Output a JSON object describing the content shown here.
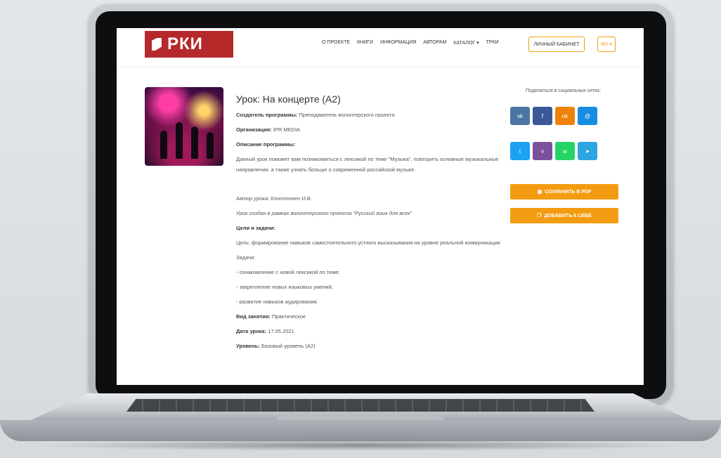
{
  "header": {
    "logo_text": "РКИ",
    "nav": [
      "О ПРОЕКТЕ",
      "КНИГИ",
      "ИНФОРМАЦИЯ",
      "АВТОРАМ",
      "КАТАЛОГ ▾",
      "ТРКИ"
    ],
    "cabinet_button": "ЛИЧНЫЙ КАБИНЕТ",
    "lang_button": "RU ▾"
  },
  "lesson": {
    "title": "Урок: На концерте (А2)",
    "creator_label": "Создатель программы:",
    "creator_value": "Преподаватель волонтерского проекта",
    "org_label": "Организация:",
    "org_value": "IPR MEDIA",
    "desc_label": "Описание программы:",
    "desc_text": "Данный урок поможет вам познакомиться с лексикой по теме \"Музыка\", повторить основные музыкальные направления, а также узнать больше о современной российской музыке.",
    "author_line": "Автор урока: Конттонен И.В.",
    "project_line": "Урок создан в рамках волонтерского проекта \"Русский язык для всех\"",
    "goals_label": "Цели и задачи:",
    "goal_text": "Цель: формирование навыков самостоятельного устного высказывания на уровне реальной коммуникации",
    "tasks_label": "Задачи:",
    "tasks": [
      "- ознакомление с новой лексикой по теме;",
      "- закрепление новых языковых умений;",
      "- развитие навыков аудирования."
    ],
    "type_label": "Вид занятия:",
    "type_value": "Практическое",
    "date_label": "Дата урока:",
    "date_value": "17.05.2021",
    "level_label": "Уровень:",
    "level_value": "Базовый уровень (А2)"
  },
  "share": {
    "label": "Поделиться в социальных сетях:",
    "buttons": [
      {
        "name": "vk",
        "glyph": "vk",
        "color": "#4c75a3"
      },
      {
        "name": "facebook",
        "glyph": "f",
        "color": "#3b5998"
      },
      {
        "name": "odnoklassniki",
        "glyph": "ok",
        "color": "#ee8208"
      },
      {
        "name": "moi-mir",
        "glyph": "@",
        "color": "#168de2"
      },
      {
        "name": "twitter",
        "glyph": "t",
        "color": "#1da1f2"
      },
      {
        "name": "viber",
        "glyph": "v",
        "color": "#7b519d"
      },
      {
        "name": "whatsapp",
        "glyph": "w",
        "color": "#25d366"
      },
      {
        "name": "telegram",
        "glyph": "➤",
        "color": "#2ca5e0"
      }
    ]
  },
  "actions": {
    "save_pdf": "СОХРАНИТЬ В PDF",
    "add_self": "ДОБАВИТЬ К СЕБЕ"
  },
  "colors": {
    "brand": "#b5292b",
    "accent": "#f39c12"
  }
}
